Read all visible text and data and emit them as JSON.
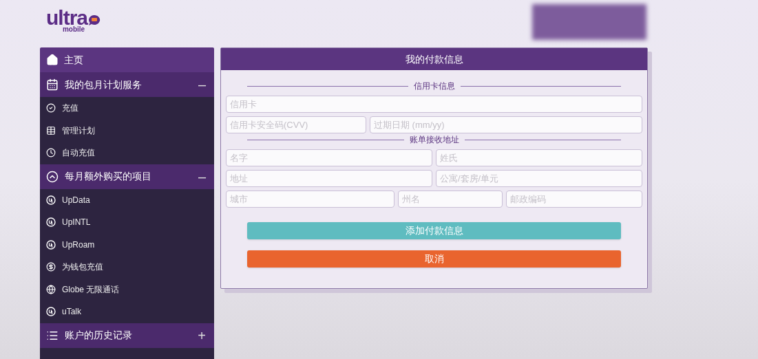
{
  "logo": {
    "word": "ultra",
    "sub": "mobile"
  },
  "sidebar": [
    {
      "kind": "link",
      "label": "主页"
    },
    {
      "kind": "section",
      "label": "我的包月计划服务",
      "toggle": "–",
      "items": [
        {
          "label": "充值"
        },
        {
          "label": "管理计划"
        },
        {
          "label": "自动充值"
        }
      ]
    },
    {
      "kind": "section",
      "label": "每月额外购买的项目",
      "toggle": "–",
      "items": [
        {
          "label": "UpData"
        },
        {
          "label": "UpINTL"
        },
        {
          "label": "UpRoam"
        },
        {
          "label": "为钱包充值"
        },
        {
          "label": "Globe 无限通话"
        },
        {
          "label": "uTalk"
        }
      ]
    },
    {
      "kind": "section",
      "label": "账户的历史记录",
      "toggle": "+"
    }
  ],
  "panel": {
    "title": "我的付款信息",
    "sections": [
      {
        "heading": "信用卡信息",
        "rows": [
          [
            {
              "placeholder": "信用卡"
            }
          ],
          [
            {
              "placeholder": "信用卡安全码(CVV)"
            },
            {
              "placeholder": "过期日期 (mm/yy)"
            }
          ]
        ]
      },
      {
        "heading": "账单接收地址",
        "rows": [
          [
            {
              "placeholder": "名字"
            },
            {
              "placeholder": "姓氏"
            }
          ],
          [
            {
              "placeholder": "地址"
            },
            {
              "placeholder": "公寓/套房/单元"
            }
          ],
          [
            {
              "placeholder": "城市"
            },
            {
              "placeholder": "州名"
            },
            {
              "placeholder": "邮政编码"
            }
          ]
        ]
      }
    ],
    "buttons": [
      {
        "kind": "primary",
        "label": "添加付款信息"
      },
      {
        "kind": "cancel",
        "label": "取消"
      }
    ]
  }
}
